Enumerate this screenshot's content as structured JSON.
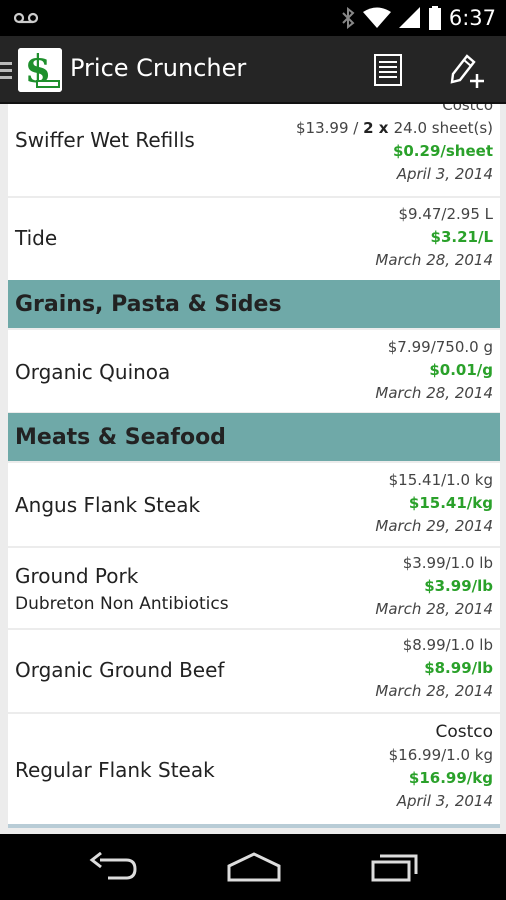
{
  "status_bar": {
    "time": "6:37",
    "icons": [
      "voicemail-icon",
      "bluetooth-icon",
      "wifi-icon",
      "signal-icon",
      "battery-icon"
    ]
  },
  "action_bar": {
    "title": "Price Cruncher",
    "icons": [
      "app-logo-icon",
      "list-icon",
      "add-edit-icon"
    ]
  },
  "list": {
    "rows": [
      {
        "name": "Swiffer Wet Refills",
        "store_partial": "Costco",
        "price": "$13.99 / ",
        "qty": "2",
        "times": " x ",
        "size": "24.0 sheet(s)",
        "unit": "$0.29/sheet",
        "date": "April 3, 2014"
      },
      {
        "name": "Tide",
        "price": "$9.47/2.95 L",
        "unit": "$3.21/L",
        "date": "March 28, 2014"
      }
    ],
    "sections": [
      {
        "title": "Grains, Pasta & Sides",
        "items": [
          {
            "name": "Organic Quinoa",
            "price": "$7.99/750.0 g",
            "unit": "$0.01/g",
            "date": "March 28, 2014"
          }
        ]
      },
      {
        "title": "Meats & Seafood",
        "items": [
          {
            "name": "Angus Flank Steak",
            "price": "$15.41/1.0 kg",
            "unit": "$15.41/kg",
            "date": "March 29, 2014"
          },
          {
            "name": "Ground Pork",
            "subtitle": "Dubreton Non Antibiotics",
            "price": "$3.99/1.0 lb",
            "unit": "$3.99/lb",
            "date": "March 28, 2014"
          },
          {
            "name": "Organic Ground Beef",
            "price": "$8.99/1.0 lb",
            "unit": "$8.99/lb",
            "date": "March 28, 2014"
          },
          {
            "name": "Regular Flank Steak",
            "store": "Costco",
            "price": "$16.99/1.0 kg",
            "unit": "$16.99/kg",
            "date": "April 3, 2014"
          }
        ]
      }
    ]
  },
  "nav_bar": {
    "icons": [
      "back-icon",
      "home-icon",
      "recent-apps-icon"
    ]
  },
  "colors": {
    "section_header": "#6fa9a8",
    "unit_price": "#2aa12a",
    "action_bar": "#252525",
    "logo_green": "#1e8f2c"
  }
}
